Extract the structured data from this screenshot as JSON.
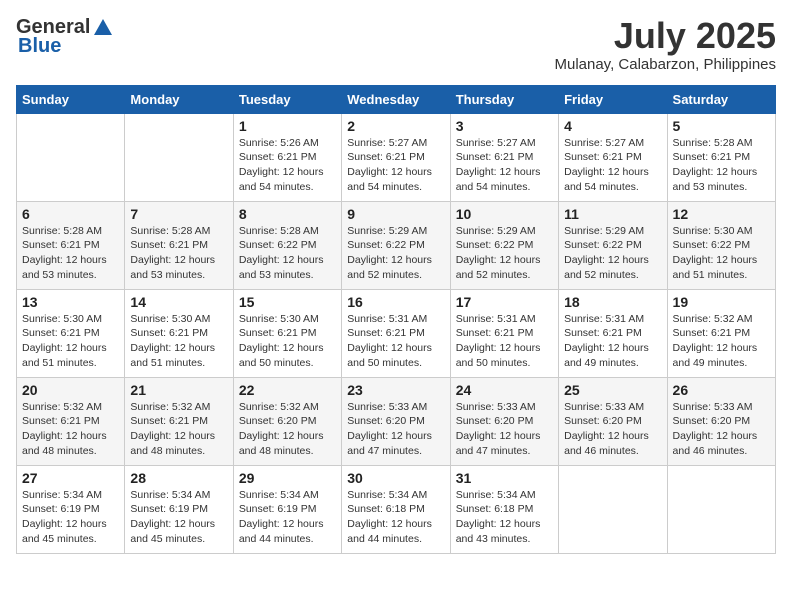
{
  "header": {
    "logo_general": "General",
    "logo_blue": "Blue",
    "month_title": "July 2025",
    "location": "Mulanay, Calabarzon, Philippines"
  },
  "weekdays": [
    "Sunday",
    "Monday",
    "Tuesday",
    "Wednesday",
    "Thursday",
    "Friday",
    "Saturday"
  ],
  "weeks": [
    [
      {
        "day": "",
        "sunrise": "",
        "sunset": "",
        "daylight": ""
      },
      {
        "day": "",
        "sunrise": "",
        "sunset": "",
        "daylight": ""
      },
      {
        "day": "1",
        "sunrise": "Sunrise: 5:26 AM",
        "sunset": "Sunset: 6:21 PM",
        "daylight": "Daylight: 12 hours and 54 minutes."
      },
      {
        "day": "2",
        "sunrise": "Sunrise: 5:27 AM",
        "sunset": "Sunset: 6:21 PM",
        "daylight": "Daylight: 12 hours and 54 minutes."
      },
      {
        "day": "3",
        "sunrise": "Sunrise: 5:27 AM",
        "sunset": "Sunset: 6:21 PM",
        "daylight": "Daylight: 12 hours and 54 minutes."
      },
      {
        "day": "4",
        "sunrise": "Sunrise: 5:27 AM",
        "sunset": "Sunset: 6:21 PM",
        "daylight": "Daylight: 12 hours and 54 minutes."
      },
      {
        "day": "5",
        "sunrise": "Sunrise: 5:28 AM",
        "sunset": "Sunset: 6:21 PM",
        "daylight": "Daylight: 12 hours and 53 minutes."
      }
    ],
    [
      {
        "day": "6",
        "sunrise": "Sunrise: 5:28 AM",
        "sunset": "Sunset: 6:21 PM",
        "daylight": "Daylight: 12 hours and 53 minutes."
      },
      {
        "day": "7",
        "sunrise": "Sunrise: 5:28 AM",
        "sunset": "Sunset: 6:21 PM",
        "daylight": "Daylight: 12 hours and 53 minutes."
      },
      {
        "day": "8",
        "sunrise": "Sunrise: 5:28 AM",
        "sunset": "Sunset: 6:22 PM",
        "daylight": "Daylight: 12 hours and 53 minutes."
      },
      {
        "day": "9",
        "sunrise": "Sunrise: 5:29 AM",
        "sunset": "Sunset: 6:22 PM",
        "daylight": "Daylight: 12 hours and 52 minutes."
      },
      {
        "day": "10",
        "sunrise": "Sunrise: 5:29 AM",
        "sunset": "Sunset: 6:22 PM",
        "daylight": "Daylight: 12 hours and 52 minutes."
      },
      {
        "day": "11",
        "sunrise": "Sunrise: 5:29 AM",
        "sunset": "Sunset: 6:22 PM",
        "daylight": "Daylight: 12 hours and 52 minutes."
      },
      {
        "day": "12",
        "sunrise": "Sunrise: 5:30 AM",
        "sunset": "Sunset: 6:22 PM",
        "daylight": "Daylight: 12 hours and 51 minutes."
      }
    ],
    [
      {
        "day": "13",
        "sunrise": "Sunrise: 5:30 AM",
        "sunset": "Sunset: 6:21 PM",
        "daylight": "Daylight: 12 hours and 51 minutes."
      },
      {
        "day": "14",
        "sunrise": "Sunrise: 5:30 AM",
        "sunset": "Sunset: 6:21 PM",
        "daylight": "Daylight: 12 hours and 51 minutes."
      },
      {
        "day": "15",
        "sunrise": "Sunrise: 5:30 AM",
        "sunset": "Sunset: 6:21 PM",
        "daylight": "Daylight: 12 hours and 50 minutes."
      },
      {
        "day": "16",
        "sunrise": "Sunrise: 5:31 AM",
        "sunset": "Sunset: 6:21 PM",
        "daylight": "Daylight: 12 hours and 50 minutes."
      },
      {
        "day": "17",
        "sunrise": "Sunrise: 5:31 AM",
        "sunset": "Sunset: 6:21 PM",
        "daylight": "Daylight: 12 hours and 50 minutes."
      },
      {
        "day": "18",
        "sunrise": "Sunrise: 5:31 AM",
        "sunset": "Sunset: 6:21 PM",
        "daylight": "Daylight: 12 hours and 49 minutes."
      },
      {
        "day": "19",
        "sunrise": "Sunrise: 5:32 AM",
        "sunset": "Sunset: 6:21 PM",
        "daylight": "Daylight: 12 hours and 49 minutes."
      }
    ],
    [
      {
        "day": "20",
        "sunrise": "Sunrise: 5:32 AM",
        "sunset": "Sunset: 6:21 PM",
        "daylight": "Daylight: 12 hours and 48 minutes."
      },
      {
        "day": "21",
        "sunrise": "Sunrise: 5:32 AM",
        "sunset": "Sunset: 6:21 PM",
        "daylight": "Daylight: 12 hours and 48 minutes."
      },
      {
        "day": "22",
        "sunrise": "Sunrise: 5:32 AM",
        "sunset": "Sunset: 6:20 PM",
        "daylight": "Daylight: 12 hours and 48 minutes."
      },
      {
        "day": "23",
        "sunrise": "Sunrise: 5:33 AM",
        "sunset": "Sunset: 6:20 PM",
        "daylight": "Daylight: 12 hours and 47 minutes."
      },
      {
        "day": "24",
        "sunrise": "Sunrise: 5:33 AM",
        "sunset": "Sunset: 6:20 PM",
        "daylight": "Daylight: 12 hours and 47 minutes."
      },
      {
        "day": "25",
        "sunrise": "Sunrise: 5:33 AM",
        "sunset": "Sunset: 6:20 PM",
        "daylight": "Daylight: 12 hours and 46 minutes."
      },
      {
        "day": "26",
        "sunrise": "Sunrise: 5:33 AM",
        "sunset": "Sunset: 6:20 PM",
        "daylight": "Daylight: 12 hours and 46 minutes."
      }
    ],
    [
      {
        "day": "27",
        "sunrise": "Sunrise: 5:34 AM",
        "sunset": "Sunset: 6:19 PM",
        "daylight": "Daylight: 12 hours and 45 minutes."
      },
      {
        "day": "28",
        "sunrise": "Sunrise: 5:34 AM",
        "sunset": "Sunset: 6:19 PM",
        "daylight": "Daylight: 12 hours and 45 minutes."
      },
      {
        "day": "29",
        "sunrise": "Sunrise: 5:34 AM",
        "sunset": "Sunset: 6:19 PM",
        "daylight": "Daylight: 12 hours and 44 minutes."
      },
      {
        "day": "30",
        "sunrise": "Sunrise: 5:34 AM",
        "sunset": "Sunset: 6:18 PM",
        "daylight": "Daylight: 12 hours and 44 minutes."
      },
      {
        "day": "31",
        "sunrise": "Sunrise: 5:34 AM",
        "sunset": "Sunset: 6:18 PM",
        "daylight": "Daylight: 12 hours and 43 minutes."
      },
      {
        "day": "",
        "sunrise": "",
        "sunset": "",
        "daylight": ""
      },
      {
        "day": "",
        "sunrise": "",
        "sunset": "",
        "daylight": ""
      }
    ]
  ]
}
